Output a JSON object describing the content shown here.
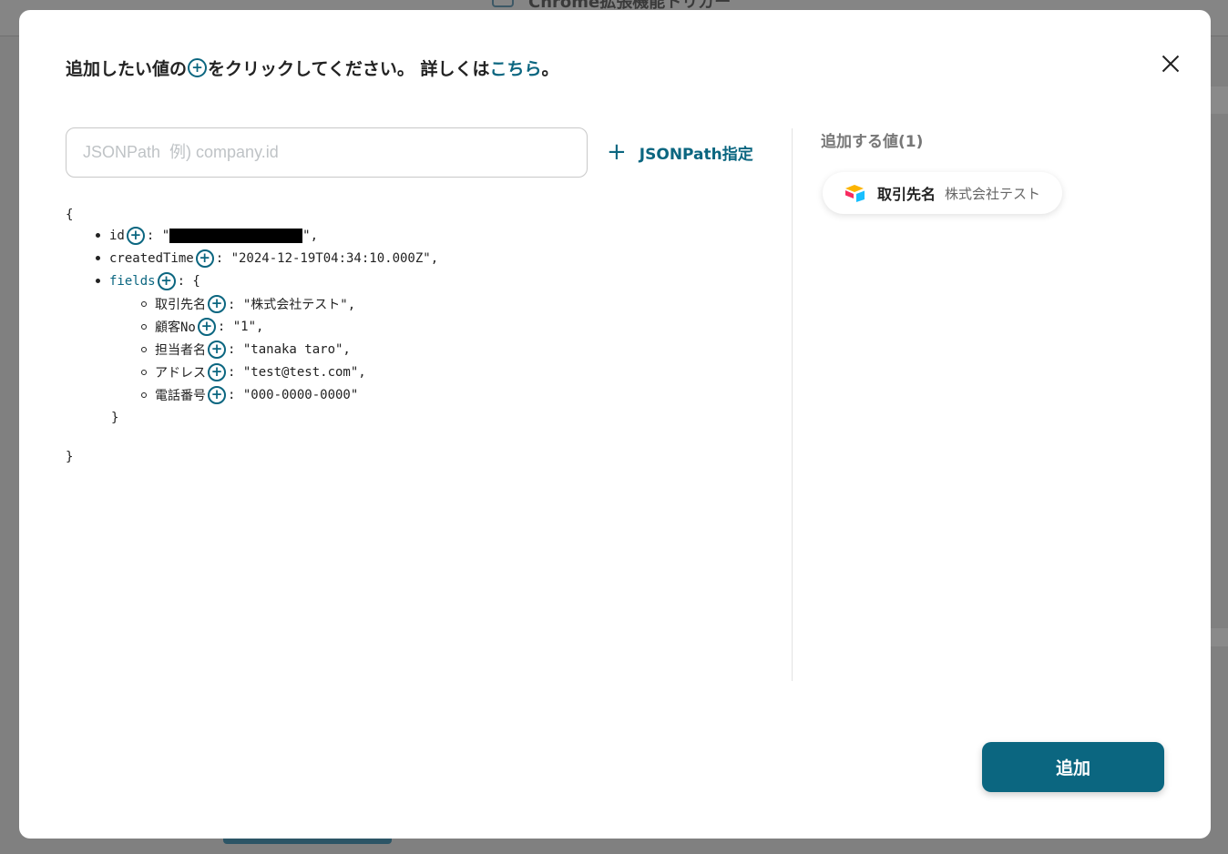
{
  "background": {
    "title": "Chrome拡張機能トリガー"
  },
  "modal": {
    "instruction_before": "追加したい値の",
    "instruction_after": "をクリックしてください。 詳しくは",
    "link_label": "こちら",
    "instruction_end": "。",
    "search": {
      "placeholder": "JSONPath  例) company.id",
      "value": ""
    },
    "jsonpath_button": "JSONPath指定",
    "json": {
      "open_brace": "{",
      "close_brace": "}",
      "fields_close": "}",
      "id_key": "id",
      "id_value_prefix": ": \"",
      "id_value_suffix": "\",",
      "created_key": "createdTime",
      "created_value": ": \"2024-12-19T04:34:10.000Z\",",
      "fields_key": "fields",
      "fields_value": ": {",
      "fields": [
        {
          "key": "取引先名",
          "value": ": \"株式会社テスト\","
        },
        {
          "key": "顧客No",
          "value": ": \"1\","
        },
        {
          "key": "担当者名",
          "value": ": \"tanaka taro\","
        },
        {
          "key": "アドレス",
          "value": ": \"test@test.com\","
        },
        {
          "key": "電話番号",
          "value": ": \"000-0000-0000\""
        }
      ]
    },
    "added_title": "追加する値(1)",
    "added_item": {
      "key": "取引先名",
      "value": "株式会社テスト",
      "icon": "airtable-icon"
    },
    "submit_label": "追加",
    "colors": {
      "accent": "#0b6680"
    }
  }
}
